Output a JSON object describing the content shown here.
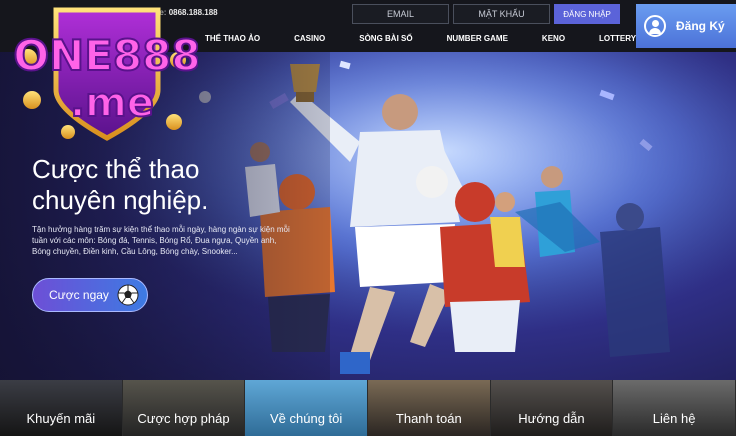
{
  "header": {
    "hotline_prefix": "line:",
    "hotline_number": "0868.188.188",
    "email_placeholder": "EMAIL",
    "password_placeholder": "MẬT KHẨU",
    "login_label": "ĐĂNG NHẬP",
    "register_label": "Đăng Ký"
  },
  "nav": [
    {
      "label": "THỂ THAO ẢO"
    },
    {
      "label": "CASINO"
    },
    {
      "label": "SÒNG BÀI SỐ"
    },
    {
      "label": "NUMBER GAME"
    },
    {
      "label": "KENO"
    },
    {
      "label": "LOTTERY"
    }
  ],
  "logo": {
    "text_line1": "ONE888",
    "text_line2": ".me"
  },
  "hero": {
    "title_line1": "Cược thể thao",
    "title_line2": "chuyên nghiệp.",
    "description": "Tận hưởng hàng trăm sự kiện thể thao mỗi ngày, hàng ngàn sự kiện mỗi tuần với các môn: Bóng đá, Tennis, Bóng Rổ, Đua ngựa, Quyền anh, Bóng chuyền, Điền kinh, Cầu Lông, Bóng chày, Snooker...",
    "cta_label": "Cược ngay"
  },
  "tiles": [
    {
      "label": "Khuyến mãi"
    },
    {
      "label": "Cược hợp pháp"
    },
    {
      "label": "Về chúng tôi"
    },
    {
      "label": "Thanh toán"
    },
    {
      "label": "Hướng dẫn"
    },
    {
      "label": "Liên hệ"
    }
  ],
  "colors": {
    "accent": "#5b63d9",
    "register": "#5a86e6"
  }
}
